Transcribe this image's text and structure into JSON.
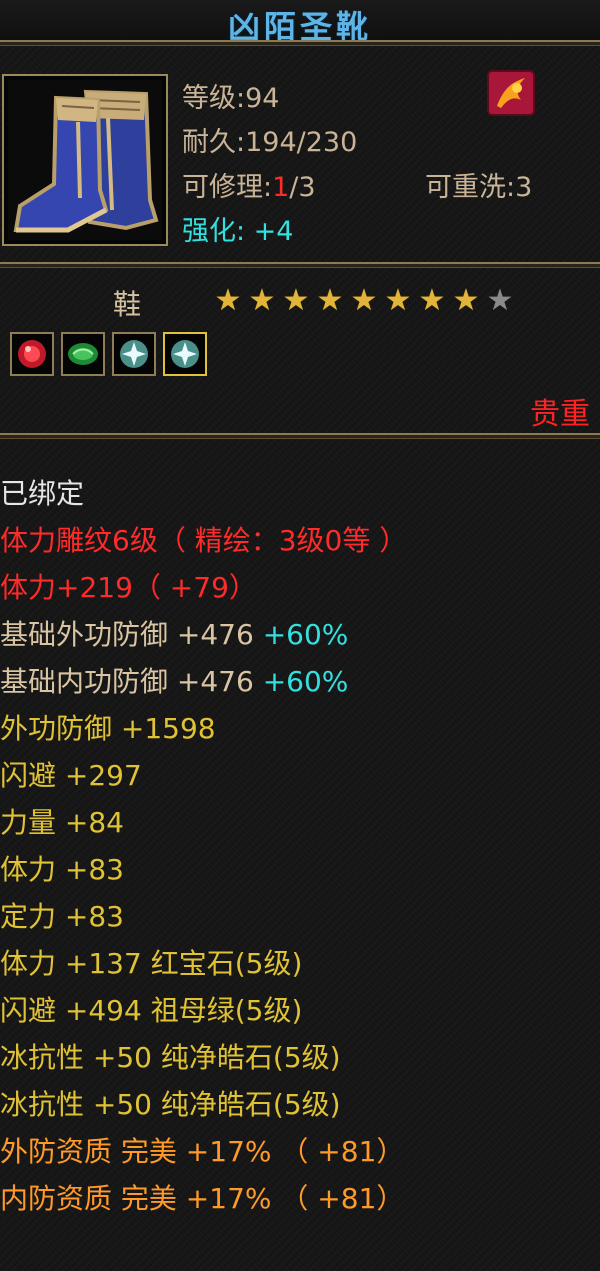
{
  "tooltip": {
    "title": "凶陌圣靴",
    "level_label": "等级:94",
    "durability_label": "耐久:194/230",
    "repair_prefix": "可修理:",
    "repair_current": "1",
    "repair_suffix": "/3",
    "reroll_label": "可重洗:3",
    "enhance_label": "强化: +4",
    "item_type": "鞋",
    "stars": {
      "filled": 8,
      "total": 9
    },
    "rarity": "贵重",
    "gems": [
      "red-gem-icon",
      "green-jade-gem-icon",
      "white-crystal-gem-icon",
      "white-crystal-gem-icon"
    ]
  },
  "attributes": [
    {
      "text": "已绑定",
      "color": "#e6e6e6"
    },
    {
      "text": "体力雕纹6级（ 精绘：3级0等 ）",
      "color": "#ff2a2a"
    },
    {
      "text": "体力+219（ +79）",
      "color": "#ff2a2a"
    },
    {
      "text": "基础外功防御 +476",
      "extra": " +60%",
      "color": "#d9c4a3",
      "extra_color": "#33e0e0"
    },
    {
      "text": "基础内功防御 +476",
      "extra": " +60%",
      "color": "#d9c4a3",
      "extra_color": "#33e0e0"
    },
    {
      "text": "外功防御 +1598",
      "color": "#e0c235"
    },
    {
      "text": "闪避 +297",
      "color": "#e0c235"
    },
    {
      "text": "力量 +84",
      "color": "#e0c235"
    },
    {
      "text": "体力 +83",
      "color": "#e0c235"
    },
    {
      "text": "定力 +83",
      "color": "#e0c235"
    },
    {
      "text": "体力 +137 红宝石(5级)",
      "color": "#e0c235"
    },
    {
      "text": "闪避 +494 祖母绿(5级)",
      "color": "#e0c235"
    },
    {
      "text": "冰抗性 +50 纯净皓石(5级)",
      "color": "#e0c235"
    },
    {
      "text": "冰抗性 +50 纯净皓石(5级)",
      "color": "#e0c235"
    },
    {
      "text": "外防资质  完美 +17% （ +81）",
      "color": "#ff9a2a"
    },
    {
      "text": "内防资质  完美 +17% （ +81）",
      "color": "#ff9a2a"
    }
  ]
}
